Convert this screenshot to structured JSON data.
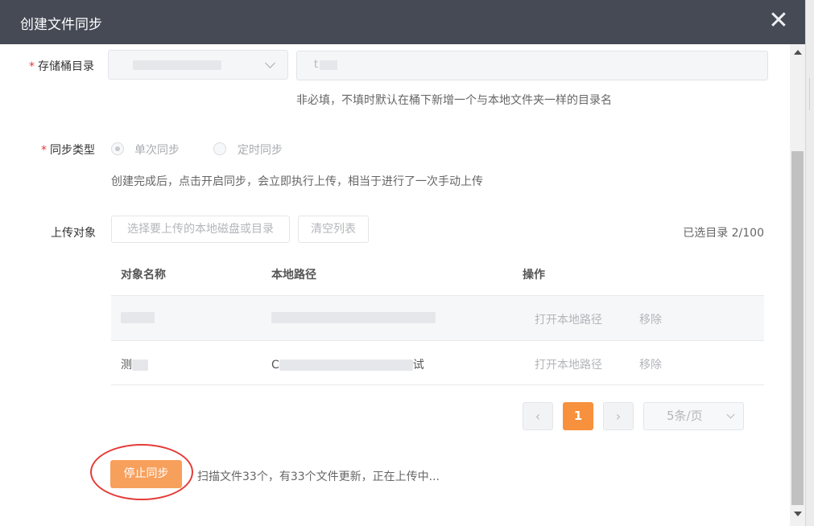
{
  "dialog": {
    "title": "创建文件同步",
    "close_icon": "close-icon"
  },
  "bucket_dir": {
    "label": "存储桶目录",
    "required_mark": "*",
    "select_value": "",
    "dir_value": "t",
    "hint": "非必填，不填时默认在桶下新增一个与本地文件夹一样的目录名"
  },
  "sync_type": {
    "label": "同步类型",
    "required_mark": "*",
    "options": [
      {
        "label": "单次同步",
        "checked": true
      },
      {
        "label": "定时同步",
        "checked": false
      }
    ],
    "hint": "创建完成后，点击开启同步，会立即执行上传，相当于进行了一次手动上传"
  },
  "upload_target": {
    "label": "上传对象",
    "select_button": "选择要上传的本地磁盘或目录",
    "clear_button": "清空列表",
    "selected_count": "已选目录 2/100"
  },
  "table": {
    "headers": [
      "对象名称",
      "本地路径",
      "操作"
    ],
    "rows": [
      {
        "name": "",
        "path": "",
        "action_open": "打开本地路径",
        "action_remove": "移除"
      },
      {
        "name": "测",
        "path": "C",
        "path_suffix": "试",
        "action_open": "打开本地路径",
        "action_remove": "移除"
      }
    ]
  },
  "pagination": {
    "prev_icon": "chevron-left-icon",
    "current_page": "1",
    "next_icon": "chevron-right-icon",
    "page_size": "5条/页"
  },
  "footer": {
    "stop_button": "停止同步",
    "status": "扫描文件33个，有33个文件更新，正在上传中..."
  },
  "colors": {
    "titlebar": "#454a55",
    "accent": "#f7913d",
    "stop_button": "#f7a05c",
    "required": "#e4393c",
    "annotation": "#e53b37"
  }
}
